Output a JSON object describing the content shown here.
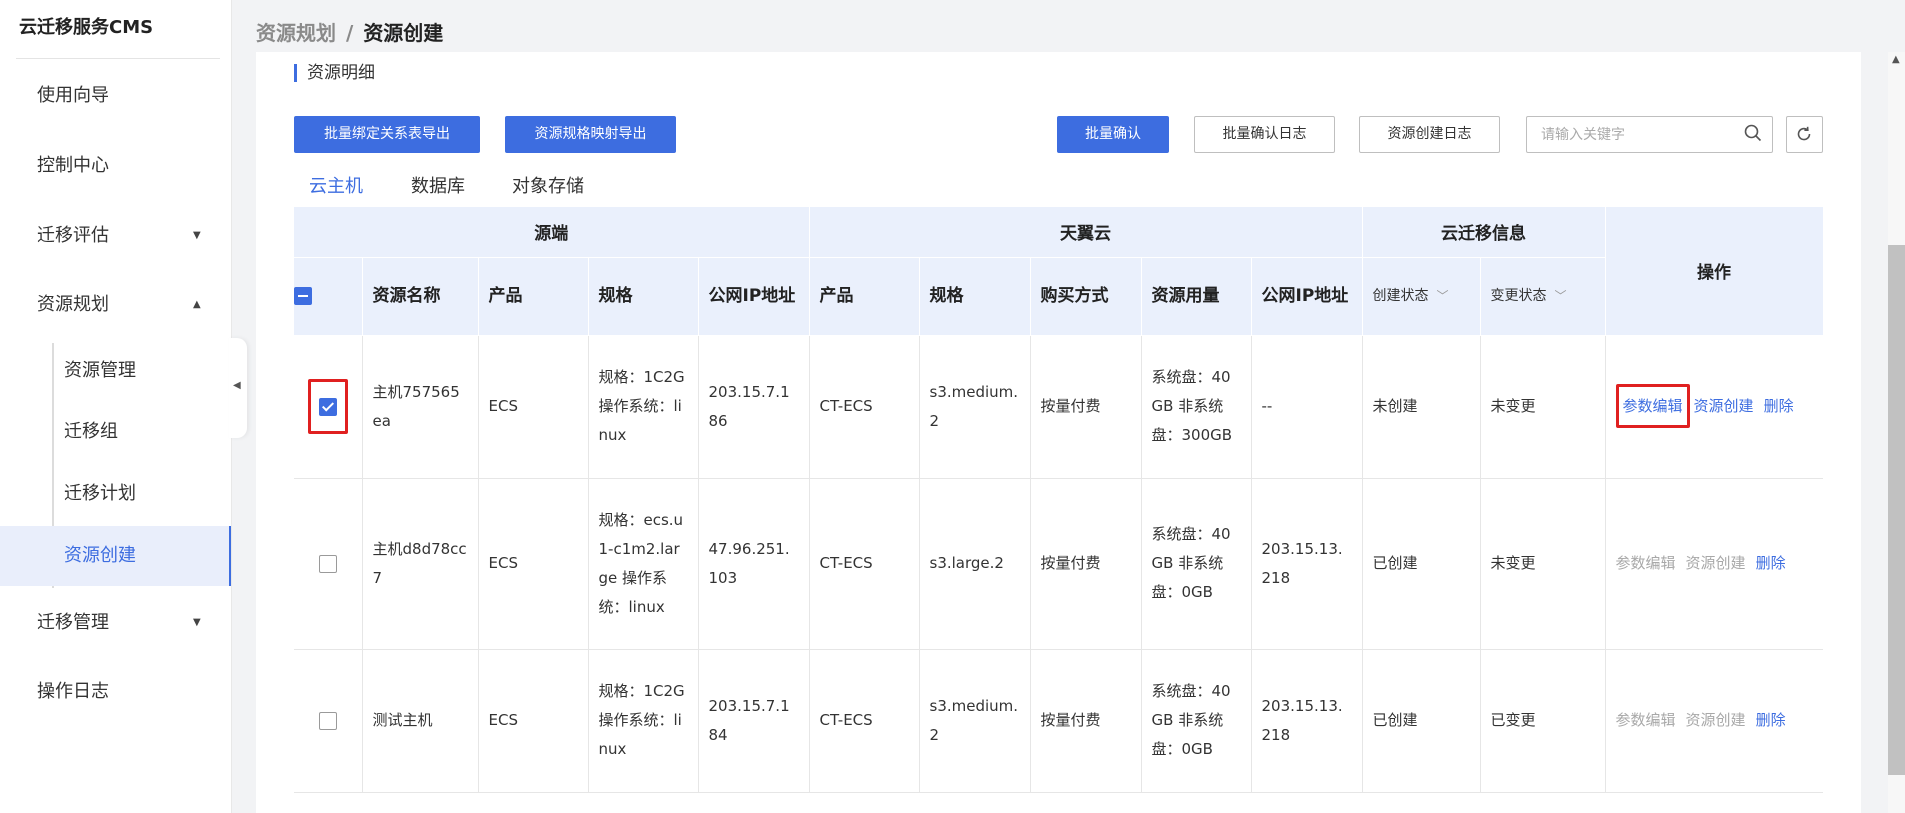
{
  "app": {
    "title": "云迁移服务CMS"
  },
  "sidebar": {
    "items": [
      {
        "label": "使用向导"
      },
      {
        "label": "控制中心"
      },
      {
        "label": "迁移评估",
        "caret": "▼"
      },
      {
        "label": "资源规划",
        "caret": "▲"
      },
      {
        "label": "迁移管理",
        "caret": "▼"
      },
      {
        "label": "操作日志"
      }
    ],
    "sub_items": [
      {
        "label": "资源管理"
      },
      {
        "label": "迁移组"
      },
      {
        "label": "迁移计划"
      },
      {
        "label": "资源创建",
        "active": true
      }
    ]
  },
  "breadcrumb": {
    "parent": "资源规划",
    "separator": "/",
    "current": "资源创建"
  },
  "section": {
    "title": "资源明细"
  },
  "toolbar": {
    "export_binding": "批量绑定关系表导出",
    "export_spec_mapping": "资源规格映射导出",
    "batch_confirm": "批量确认",
    "batch_confirm_log": "批量确认日志",
    "resource_create_log": "资源创建日志",
    "search_placeholder": "请输入关键字",
    "search_value": ""
  },
  "tabs": [
    {
      "label": "云主机",
      "active": true
    },
    {
      "label": "数据库"
    },
    {
      "label": "对象存储"
    }
  ],
  "table": {
    "groups": {
      "source": "源端",
      "cloud": "天翼云",
      "migration": "云迁移信息",
      "ops": "操作"
    },
    "columns": {
      "name": "资源名称",
      "product": "产品",
      "spec": "规格",
      "public_ip": "公网IP地址",
      "t_product": "产品",
      "t_spec": "规格",
      "purchase": "购买方式",
      "usage": "资源用量",
      "t_ip": "公网IP地址",
      "create_status": "创建状态",
      "change_status": "变更状态"
    },
    "rows": [
      {
        "checked": true,
        "name": "主机757565ea",
        "product": "ECS",
        "spec": "规格：1C2G 操作系统：linux",
        "public_ip": "203.15.7.186",
        "t_product": "CT-ECS",
        "t_spec": "s3.medium.2",
        "purchase": "按量付费",
        "usage": "系统盘：40GB 非系统盘：300GB",
        "t_ip": "--",
        "create_status": "未创建",
        "change_status": "未变更",
        "op_edit": "参数编辑",
        "op_create": "资源创建",
        "op_delete": "删除"
      },
      {
        "checked": false,
        "name": "主机d8d78cc7",
        "product": "ECS",
        "spec": "规格：ecs.u1-c1m2.large 操作系统：linux",
        "public_ip": "47.96.251.103",
        "t_product": "CT-ECS",
        "t_spec": "s3.large.2",
        "purchase": "按量付费",
        "usage": "系统盘：40GB 非系统盘：0GB",
        "t_ip": "203.15.13.218",
        "create_status": "已创建",
        "change_status": "未变更",
        "op_edit": "参数编辑",
        "op_create": "资源创建",
        "op_delete": "删除"
      },
      {
        "checked": false,
        "name": "测试主机",
        "product": "ECS",
        "spec": "规格：1C2G 操作系统：linux",
        "public_ip": "203.15.7.184",
        "t_product": "CT-ECS",
        "t_spec": "s3.medium.2",
        "purchase": "按量付费",
        "usage": "系统盘：40GB 非系统盘：0GB",
        "t_ip": "203.15.13.218",
        "create_status": "已创建",
        "change_status": "已变更",
        "op_edit": "参数编辑",
        "op_create": "资源创建",
        "op_delete": "删除"
      }
    ]
  },
  "colors": {
    "accent": "#3d6de0",
    "highlight": "#e02020",
    "header_bg": "#eaf0fc"
  }
}
